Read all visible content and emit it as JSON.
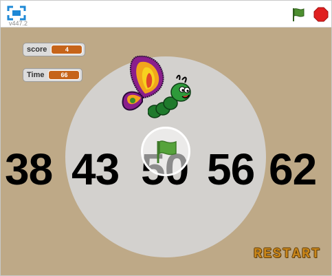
{
  "toolbar": {
    "version": "v447.2",
    "icons": {
      "fullscreen": "fullscreen-icon",
      "flag": "green-flag-icon",
      "stop": "stop-icon"
    },
    "colors": {
      "fullscreen": "#1e88d6",
      "flag": "#4d8f2f",
      "stop": "#e02020"
    }
  },
  "stage": {
    "background": "#bea987",
    "monitors": [
      {
        "label": "score",
        "value": "4"
      },
      {
        "label": "Time",
        "value": "66"
      }
    ],
    "numbers": [
      "38",
      "43",
      "50",
      "56",
      "62"
    ],
    "restart_label": "RESTART",
    "sprites": {
      "butterfly": "butterfly-sprite",
      "caterpillar": "caterpillar-sprite"
    },
    "play_overlay_icon": "green-flag-icon"
  }
}
